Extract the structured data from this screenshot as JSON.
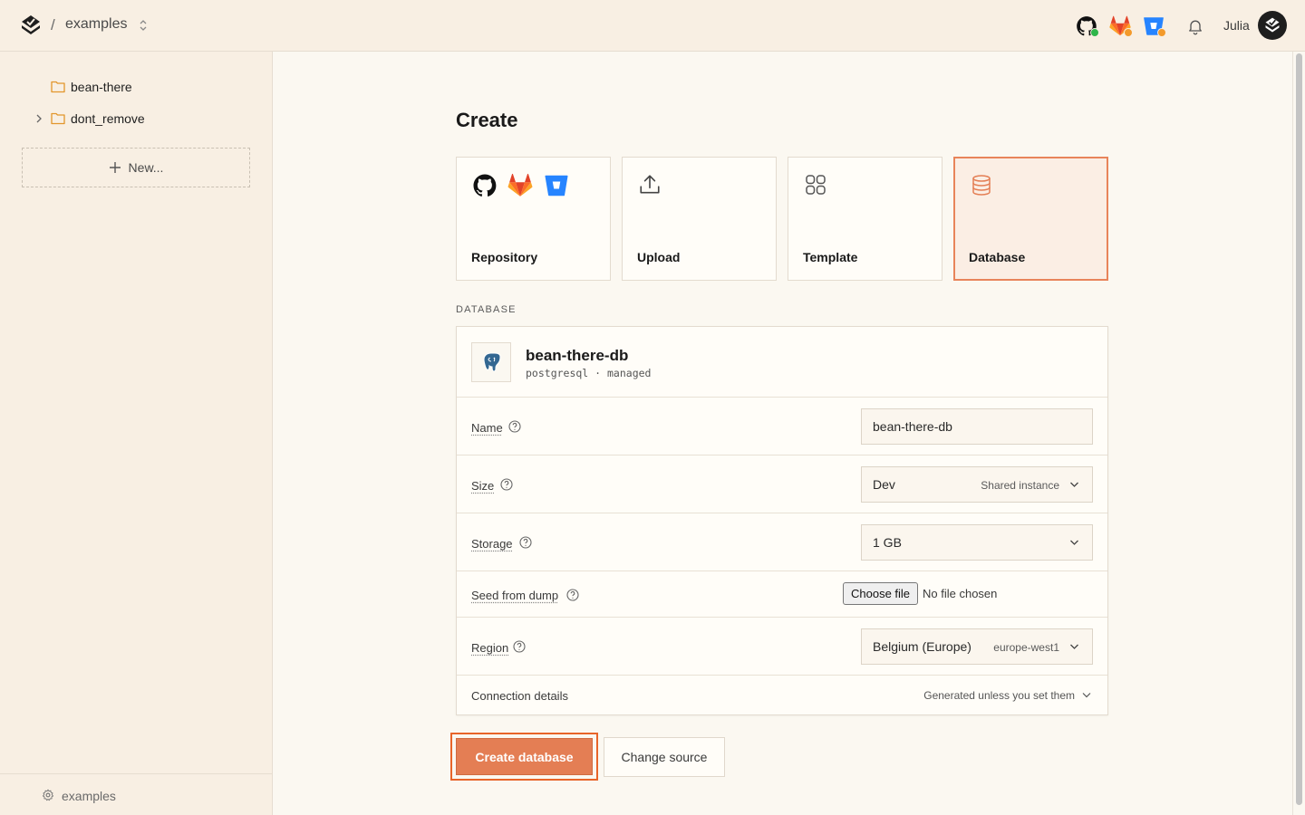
{
  "topbar": {
    "breadcrumb_sep": "/",
    "project": "examples",
    "username": "Julia",
    "icons": [
      "github-icon",
      "gitlab-icon",
      "bitbucket-icon",
      "bell-icon"
    ],
    "status_colors": {
      "github": "#2fb54a",
      "gitlab": "#f39a2b",
      "bitbucket": "#f39a2b"
    }
  },
  "sidebar": {
    "items": [
      {
        "label": "bean-there",
        "expandable": false
      },
      {
        "label": "dont_remove",
        "expandable": true
      }
    ],
    "new_label": "New...",
    "footer_label": "examples"
  },
  "main": {
    "title": "Create",
    "cards": [
      {
        "label": "Repository"
      },
      {
        "label": "Upload"
      },
      {
        "label": "Template"
      },
      {
        "label": "Database",
        "selected": true
      }
    ],
    "section_label": "DATABASE",
    "database": {
      "name": "bean-there-db",
      "meta": "postgresql · managed"
    },
    "fields": {
      "name": {
        "label": "Name",
        "value": "bean-there-db"
      },
      "size": {
        "label": "Size",
        "value": "Dev",
        "hint": "Shared instance"
      },
      "storage": {
        "label": "Storage",
        "value": "1 GB"
      },
      "seed": {
        "label": "Seed from dump",
        "button": "Choose file",
        "status": "No file chosen"
      },
      "region": {
        "label": "Region",
        "value": "Belgium (Europe)",
        "hint": "europe-west1"
      }
    },
    "connection": {
      "label": "Connection details",
      "hint": "Generated unless you set them"
    },
    "actions": {
      "primary": "Create database",
      "secondary": "Change source"
    }
  },
  "colors": {
    "accent": "#e47e54",
    "accent_border": "#e8652a",
    "sidebar_bg": "#f8efe3",
    "page_bg": "#fbf8f1"
  }
}
